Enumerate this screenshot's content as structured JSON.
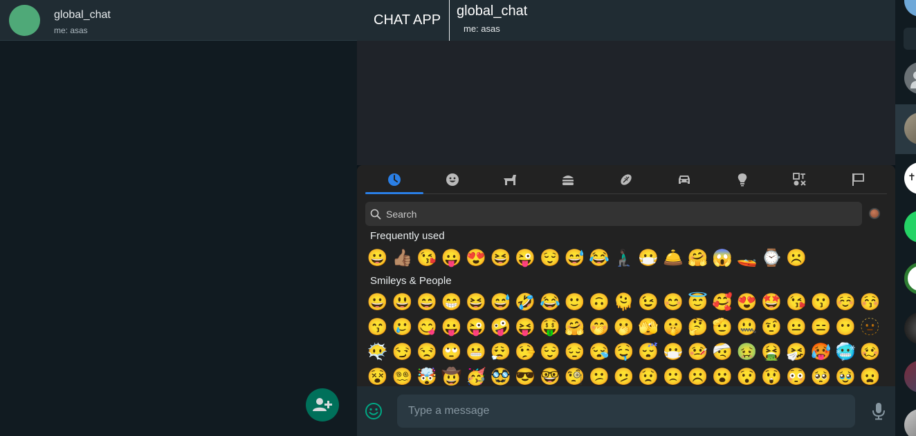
{
  "left": {
    "chat_title": "global_chat",
    "chat_sub": "me: asas",
    "avatar_color": "#4fa978",
    "fab_icon": "add-user-icon"
  },
  "header": {
    "brand": "CHAT APP",
    "title": "global_chat",
    "sub": "me: asas"
  },
  "picker": {
    "tabs": [
      "clock-icon",
      "smiley-icon",
      "animal-icon",
      "food-icon",
      "activity-icon",
      "car-icon",
      "lightbulb-icon",
      "symbols-icon",
      "flag-icon"
    ],
    "active_tab": 0,
    "search_placeholder": "Search",
    "frequent_label": "Frequently used",
    "frequent": [
      "😀",
      "👍🏽",
      "😘",
      "😛",
      "😍",
      "😆",
      "😜",
      "😌",
      "😅",
      "😂",
      "🧎🏿‍♂️",
      "😷",
      "🛎️",
      "🤗",
      "😱",
      "🚤",
      "⌚",
      "☹️"
    ],
    "smileys_label": "Smileys & People",
    "smileys_rows": [
      [
        "😀",
        "😃",
        "😄",
        "😁",
        "😆",
        "😅",
        "🤣",
        "😂",
        "🙂",
        "🙃",
        "🫠",
        "😉",
        "😊",
        "😇",
        "🥰",
        "😍",
        "🤩",
        "😘",
        "😗",
        "☺️",
        "😚"
      ],
      [
        "😙",
        "🥲",
        "😋",
        "😛",
        "😜",
        "🤪",
        "😝",
        "🤑",
        "🤗",
        "🤭",
        "🫢",
        "🫣",
        "🤫",
        "🤔",
        "🫡",
        "🤐",
        "🤨",
        "😐",
        "😑",
        "😶",
        "🫥"
      ],
      [
        "😶‍🌫️",
        "😏",
        "😒",
        "🙄",
        "😬",
        "😮‍💨",
        "🤥",
        "😌",
        "😔",
        "😪",
        "🤤",
        "😴",
        "😷",
        "🤒",
        "🤕",
        "🤢",
        "🤮",
        "🤧",
        "🥵",
        "🥶",
        "🥴"
      ],
      [
        "😵",
        "😵‍💫",
        "🤯",
        "🤠",
        "🥳",
        "🥸",
        "😎",
        "🤓",
        "🧐",
        "😕",
        "🫤",
        "😟",
        "🙁",
        "☹️",
        "😮",
        "😯",
        "😲",
        "😳",
        "🥺",
        "🥹",
        "😦"
      ]
    ],
    "skin_tone": "#a0573d"
  },
  "footer": {
    "placeholder": "Type a message",
    "emoji_icon": "smiley-icon",
    "mic_icon": "mic-icon"
  },
  "colors": {
    "accent": "#2a7fe6",
    "fab": "#00705a",
    "panel": "#202c33",
    "background": "#111b21"
  }
}
